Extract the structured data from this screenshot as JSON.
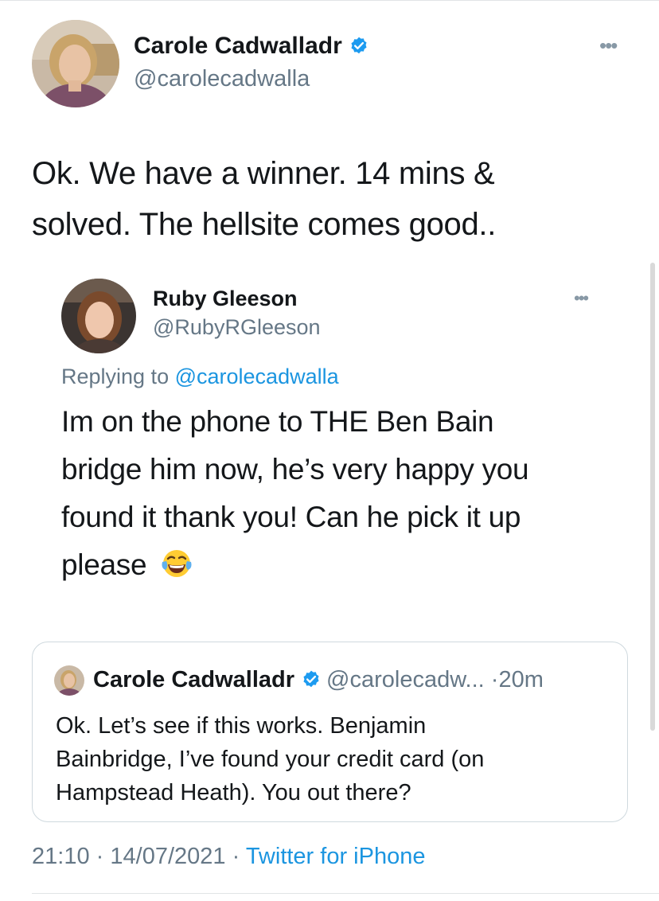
{
  "tweet": {
    "author_name": "Carole Cadwalladr",
    "author_handle": "@carolecadwalla",
    "verified": true,
    "text_line1": "Ok. We have a winner. 14 mins &",
    "text_line2": "solved. The hellsite comes good..",
    "more_label": "•••"
  },
  "reply": {
    "author_name": "Ruby Gleeson",
    "author_handle": "@RubyRGleeson",
    "replying_prefix": "Replying to",
    "replying_handle": "@carolecadwalla",
    "text_line1": "Im on the phone to THE Ben Bain",
    "text_line2": "bridge him now, he’s very happy you",
    "text_line3": "found it thank you! Can he pick it up",
    "text_line4": "please",
    "emoji_icon": "face-with-tears-of-joy",
    "more_label": "•••"
  },
  "quoted_tweet": {
    "author_name": "Carole Cadwalladr",
    "author_handle": "@carolecadw...",
    "separator": "·",
    "time": "20m",
    "verified": true,
    "text_line1": "Ok. Let’s see if this works. Benjamin",
    "text_line2": "Bainbridge, I’ve found your credit card (on",
    "text_line3": "Hampstead Heath). You out there?"
  },
  "meta": {
    "time": "21:10",
    "sep1": "·",
    "date": "14/07/2021",
    "sep2": "·",
    "source": "Twitter for iPhone"
  },
  "colors": {
    "link_blue": "#1b95e0",
    "verified_blue": "#1d9bf0",
    "secondary_gray": "#657786",
    "border_gray": "#cfd9de"
  },
  "icons": {
    "verified": "verified-badge-icon",
    "more": "more-horizontal-icon",
    "emoji": "tears-of-joy-emoji-icon"
  }
}
